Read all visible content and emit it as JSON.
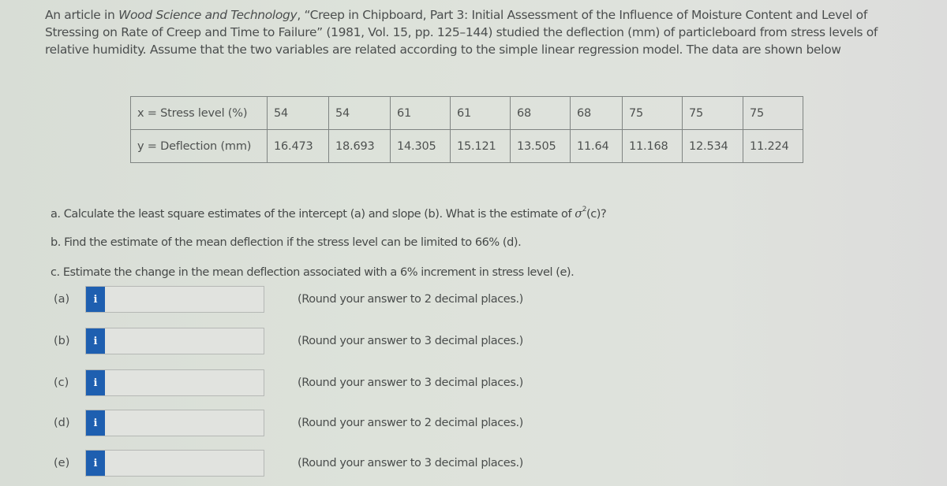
{
  "intro": {
    "prefix": "An article in ",
    "journal": "Wood Science and Technology",
    "suffix": ", “Creep in Chipboard, Part 3: Initial Assessment of the Influence of Moisture Content and Level of Stressing on Rate of Creep and Time to Failure” (1981, Vol. 15, pp. 125–144) studied the deflection (mm) of particleboard from stress levels of relative humidity. Assume that the two variables are related according to the simple linear regression model. The data are shown below"
  },
  "table": {
    "x_label": "x = Stress level (%)",
    "y_label": "y = Deflection (mm)",
    "x_values": [
      "54",
      "54",
      "61",
      "61",
      "68",
      "68",
      "75",
      "75",
      "75"
    ],
    "y_values": [
      "16.473",
      "18.693",
      "14.305",
      "15.121",
      "13.505",
      "11.64",
      "11.168",
      "12.534",
      "11.224"
    ]
  },
  "questions": {
    "a_pre": "a. Calculate the least square estimates of the intercept (a) and slope (b). What is the estimate of ",
    "a_sigma": "σ",
    "a_sup": "2",
    "a_post": "(c)?",
    "b": "b. Find the estimate of the mean deflection if the stress level can be limited to 66% (d).",
    "c": "c. Estimate the change in the mean deflection associated with a 6% increment in stress level (e)."
  },
  "answers": [
    {
      "label": "(a)",
      "value": "",
      "hint": "(Round your answer to 2 decimal places.)",
      "info_icon": "i"
    },
    {
      "label": "(b)",
      "value": "",
      "hint": "(Round your answer to 3 decimal places.)",
      "info_icon": "i"
    },
    {
      "label": "(c)",
      "value": "",
      "hint": "(Round your answer to 3 decimal places.)",
      "info_icon": "i"
    },
    {
      "label": "(d)",
      "value": "",
      "hint": "(Round your answer to 2 decimal places.)",
      "info_icon": "i"
    },
    {
      "label": "(e)",
      "value": "",
      "hint": "(Round your answer to 3 decimal places.)",
      "info_icon": "i"
    }
  ],
  "colors": {
    "info_button": "#1e5fb0",
    "background": "#dde2da"
  }
}
